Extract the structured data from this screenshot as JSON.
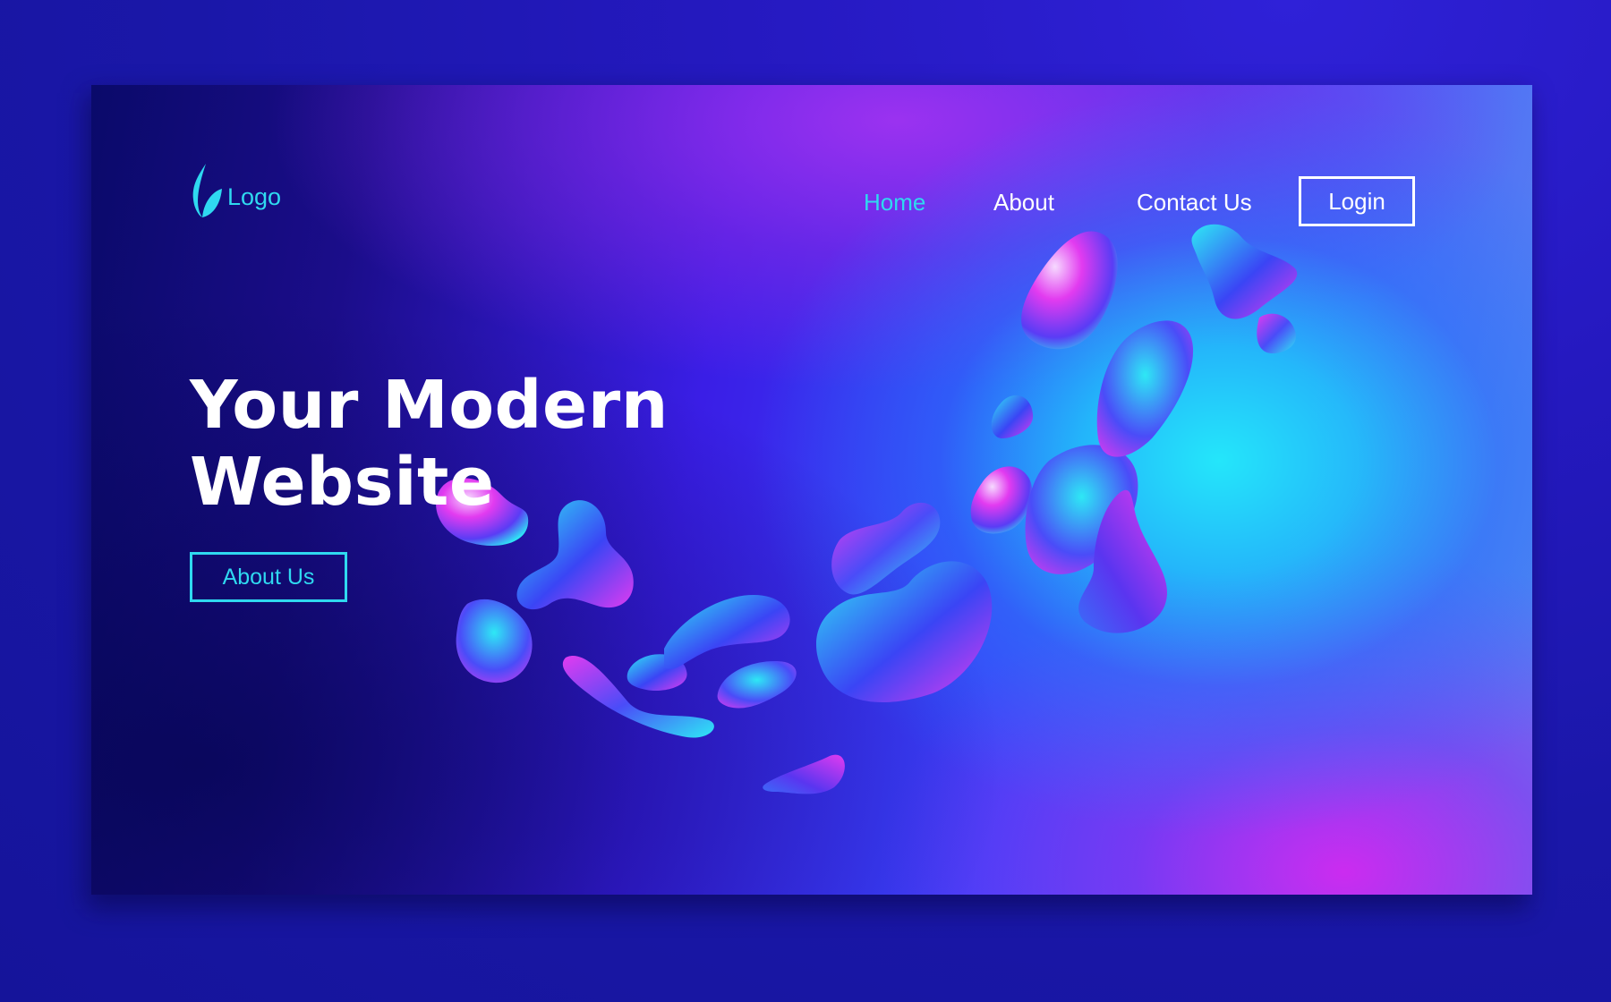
{
  "brand": {
    "logo_text": "Logo",
    "logo_icon": "leaf-icon"
  },
  "nav": {
    "items": [
      {
        "label": "Home",
        "active": true
      },
      {
        "label": "About",
        "active": false
      },
      {
        "label": "Contact Us",
        "active": false
      }
    ],
    "login_label": "Login"
  },
  "hero": {
    "title_line1": "Your Modern",
    "title_line2": "Website",
    "cta_label": "About Us"
  },
  "colors": {
    "accent_cyan": "#2fd9f0",
    "text_white": "#ffffff",
    "outer_background": "#1f19b8",
    "blob_magenta": "#e23bf0",
    "blob_cyan": "#2ee8f5",
    "blob_blue": "#3a35f0"
  }
}
